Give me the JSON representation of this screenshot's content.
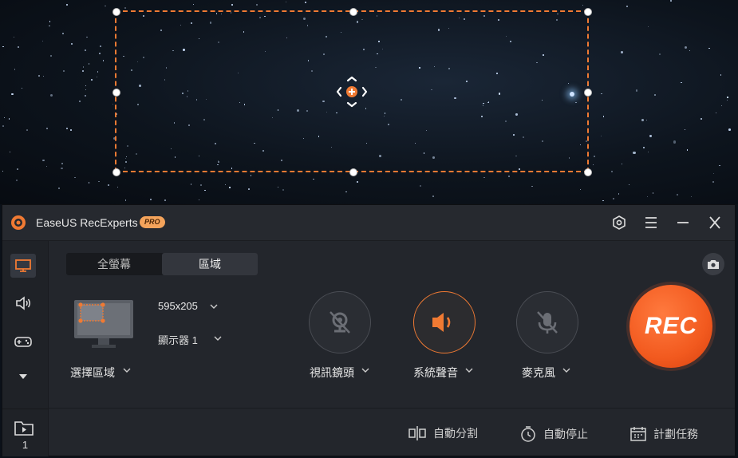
{
  "app": {
    "title": "EaseUS RecExperts",
    "badge": "PRO"
  },
  "titlebar": {
    "icons": [
      "settings-icon",
      "menu-icon",
      "minimize-icon",
      "close-icon"
    ]
  },
  "sidebar": {
    "items": [
      "screen-icon",
      "audio-icon",
      "game-icon",
      "more-down-icon"
    ],
    "folder_count": "1"
  },
  "tabs": [
    {
      "label": "全螢幕"
    },
    {
      "label": "區域"
    }
  ],
  "area": {
    "size": "595x205",
    "display": "顯示器 1",
    "select_label": "選擇區域"
  },
  "sources": [
    {
      "label": "視訊鏡頭",
      "icon": "webcam-off-icon",
      "active": false
    },
    {
      "label": "系統聲音",
      "icon": "speaker-icon",
      "active": true
    },
    {
      "label": "麥克風",
      "icon": "microphone-off-icon",
      "active": false
    }
  ],
  "rec": {
    "label": "REC"
  },
  "footer": [
    {
      "label": "自動分割",
      "icon": "split-icon"
    },
    {
      "label": "自動停止",
      "icon": "timer-icon"
    },
    {
      "label": "計劃任務",
      "icon": "schedule-icon"
    }
  ],
  "colors": {
    "accent": "#f07a33",
    "panel": "#23262c",
    "rec": "#f25a1f"
  }
}
